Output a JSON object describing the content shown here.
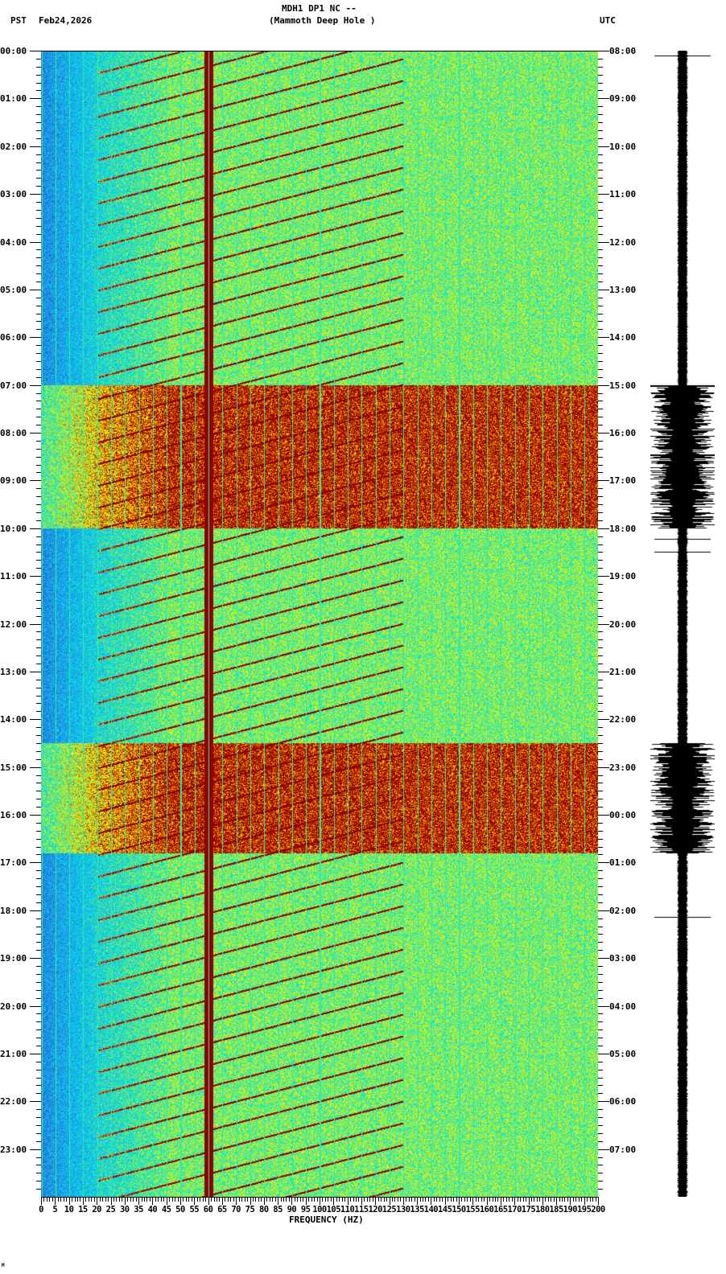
{
  "chart_data": {
    "type": "heatmap",
    "title": "MDH1 DP1 NC --",
    "subtitle": "(Mammoth Deep Hole )",
    "left_timezone": "PST",
    "date": "Feb24,2026",
    "right_timezone": "UTC",
    "xlabel": "FREQUENCY (HZ)",
    "xlim": [
      0,
      200
    ],
    "x_ticks": [
      "0",
      "5",
      "10",
      "15",
      "20",
      "25",
      "30",
      "35",
      "40",
      "45",
      "50",
      "55",
      "60",
      "65",
      "70",
      "75",
      "80",
      "85",
      "90",
      "95",
      "100",
      "105",
      "110",
      "115",
      "120",
      "125",
      "130",
      "135",
      "140",
      "145",
      "150",
      "155",
      "160",
      "165",
      "170",
      "175",
      "180",
      "185",
      "190",
      "195",
      "200"
    ],
    "y_ticks_left": [
      "00:00",
      "01:00",
      "02:00",
      "03:00",
      "04:00",
      "05:00",
      "06:00",
      "07:00",
      "08:00",
      "09:00",
      "10:00",
      "11:00",
      "12:00",
      "13:00",
      "14:00",
      "15:00",
      "16:00",
      "17:00",
      "18:00",
      "19:00",
      "20:00",
      "21:00",
      "22:00",
      "23:00"
    ],
    "y_ticks_right": [
      "08:00",
      "09:00",
      "10:00",
      "11:00",
      "12:00",
      "13:00",
      "14:00",
      "15:00",
      "16:00",
      "17:00",
      "18:00",
      "19:00",
      "20:00",
      "21:00",
      "22:00",
      "23:00",
      "00:00",
      "01:00",
      "02:00",
      "03:00",
      "04:00",
      "05:00",
      "06:00",
      "07:00"
    ],
    "noisy_periods_pst_hours": [
      [
        7,
        10
      ],
      [
        14.5,
        16.8
      ]
    ],
    "strong_line_hz": 60,
    "colors": {
      "low": "#1e64d2",
      "mid": "#00e6e6",
      "high": "#f0f000",
      "peak": "#8b0000"
    }
  },
  "footer_mark": "M"
}
